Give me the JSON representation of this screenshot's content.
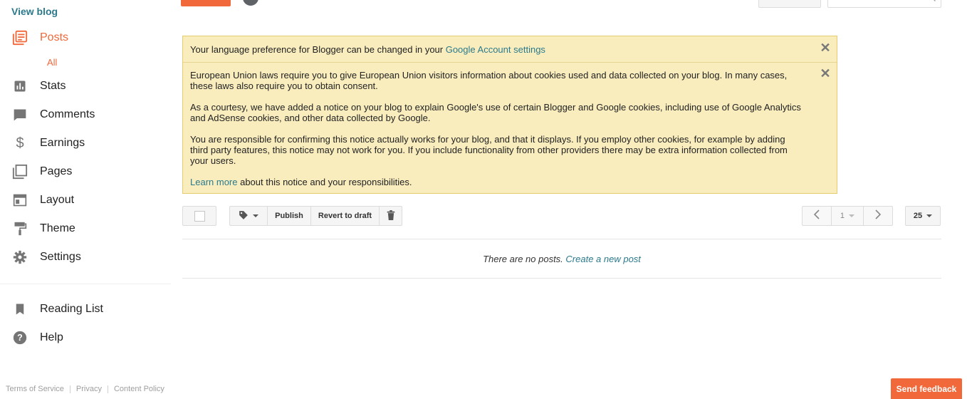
{
  "sidebar": {
    "view_blog": "View blog",
    "items": [
      {
        "label": "Posts",
        "icon": "posts-icon"
      },
      {
        "label": "Stats",
        "icon": "stats-icon"
      },
      {
        "label": "Comments",
        "icon": "comments-icon"
      },
      {
        "label": "Earnings",
        "icon": "dollar-icon"
      },
      {
        "label": "Pages",
        "icon": "pages-icon"
      },
      {
        "label": "Layout",
        "icon": "layout-icon"
      },
      {
        "label": "Theme",
        "icon": "paint-roller-icon"
      },
      {
        "label": "Settings",
        "icon": "gear-icon"
      }
    ],
    "posts_sub": "All",
    "secondary": [
      {
        "label": "Reading List",
        "icon": "bookmark-icon"
      },
      {
        "label": "Help",
        "icon": "help-icon"
      }
    ],
    "footer": {
      "terms": "Terms of Service",
      "privacy": "Privacy",
      "content_policy": "Content Policy"
    }
  },
  "notices": {
    "language": {
      "text": "Your language preference for Blogger can be changed in your ",
      "link": "Google Account settings"
    },
    "cookies": {
      "p1": "European Union laws require you to give European Union visitors information about cookies used and data collected on your blog. In many cases, these laws also require you to obtain consent.",
      "p2": "As a courtesy, we have added a notice on your blog to explain Google's use of certain Blogger and Google cookies, including use of Google Analytics and AdSense cookies, and other data collected by Google.",
      "p3": "You are responsible for confirming this notice actually works for your blog, and that it displays. If you employ other cookies, for example by adding third party features, this notice may not work for you. If you include functionality from other providers there may be extra information collected from your users.",
      "learn_more": "Learn more",
      "learn_more_suffix": " about this notice and your responsibilities."
    }
  },
  "toolbar": {
    "publish": "Publish",
    "revert": "Revert to draft",
    "page": "1",
    "per_page": "25"
  },
  "posts": {
    "empty_text": "There are no posts. ",
    "create_link": "Create a new post"
  },
  "feedback": "Send feedback",
  "colors": {
    "accent": "#f1683a",
    "link": "#2b7a8c",
    "notice_bg": "#f9edbe"
  }
}
